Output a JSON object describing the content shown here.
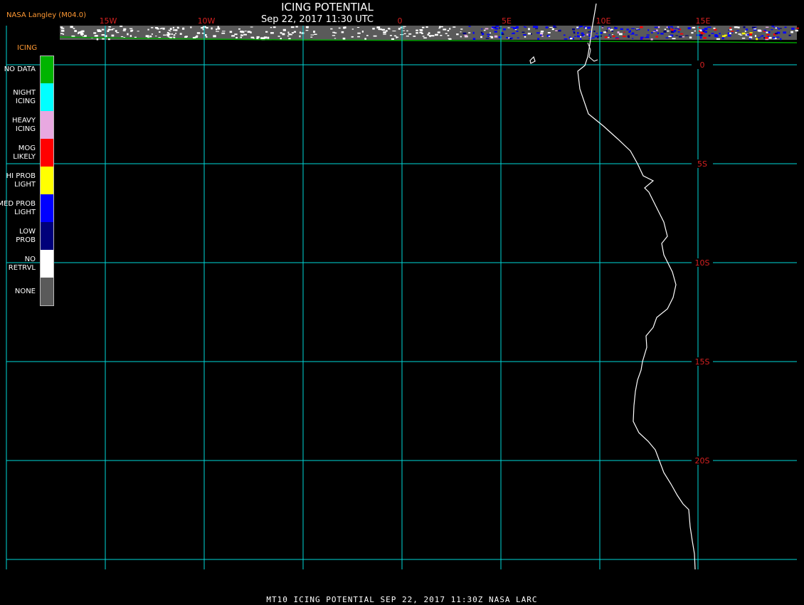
{
  "header": {
    "title": "ICING POTENTIAL",
    "subtitle": "Sep 22, 2017 11:30 UTC",
    "brand": "NASA Langley (M04.0)"
  },
  "footer": {
    "text": "MT10  ICING POTENTIAL   SEP 22, 2017 11:30Z   NASA LARC"
  },
  "legend": {
    "title": "ICING",
    "items": [
      {
        "label": "NO DATA",
        "color": "#00b400"
      },
      {
        "label": "NIGHT ICING",
        "color": "#00ffff"
      },
      {
        "label": "HEAVY ICING",
        "color": "#e8a8e0"
      },
      {
        "label": "MOG LIKELY",
        "color": "#ff0000"
      },
      {
        "label": "HI PROB LIGHT",
        "color": "#ffff00"
      },
      {
        "label": "MED PROB LIGHT",
        "color": "#0000ff"
      },
      {
        "label": "LOW PROB",
        "color": "#00007a"
      },
      {
        "label": "NO RETRVL",
        "color": "#ffffff"
      },
      {
        "label": "NONE",
        "color": "#5a5a5a"
      }
    ]
  },
  "grid": {
    "line_color": "#00d8d8",
    "label_color": "#d42020",
    "longitude_labels": [
      "15W",
      "10W",
      "0",
      "5E",
      "10E",
      "15E"
    ],
    "latitude_labels": [
      "0",
      "5S",
      "10S",
      "15S",
      "20S"
    ]
  },
  "coastline_color": "#ffffff"
}
